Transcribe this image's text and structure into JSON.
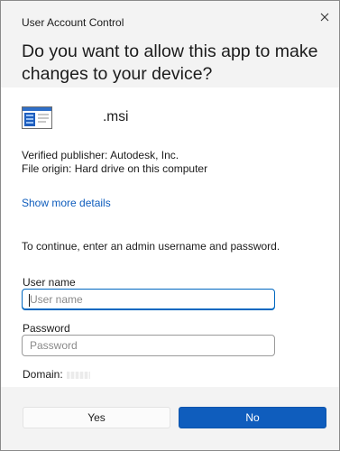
{
  "window": {
    "title": "User Account Control",
    "close_icon": "close-icon"
  },
  "prompt": {
    "question": "Do you want to allow this app to make changes to your device?"
  },
  "app": {
    "icon": "msi-installer-icon",
    "file_name": ".msi",
    "publisher_line": "Verified publisher: Autodesk, Inc.",
    "origin_line": "File origin: Hard drive on this computer"
  },
  "details_link": "Show more details",
  "credentials": {
    "instruction": "To continue, enter an admin username and password.",
    "username_label": "User name",
    "username_value": "",
    "username_placeholder": "User name",
    "password_label": "Password",
    "password_value": "",
    "password_placeholder": "Password",
    "domain_label": "Domain:"
  },
  "buttons": {
    "yes": "Yes",
    "no": "No"
  },
  "colors": {
    "accent": "#0f5dbd",
    "focus_border": "#0067c0",
    "header_bg": "#f3f3f3"
  }
}
